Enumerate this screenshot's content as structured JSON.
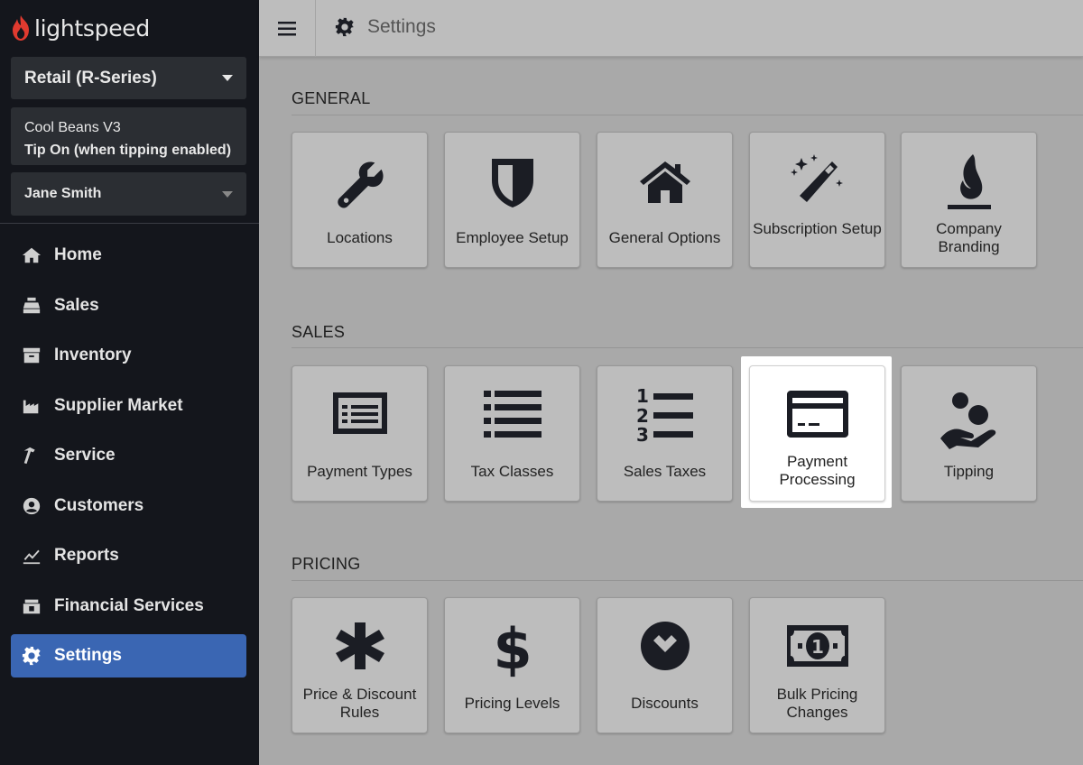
{
  "app": {
    "logo_text": "lightspeed"
  },
  "sidebar": {
    "product_selector": "Retail (R-Series)",
    "shop": {
      "name": "Cool Beans V3",
      "tip_status": "Tip On (when tipping enabled)"
    },
    "user": "Jane Smith",
    "items": [
      {
        "label": "Home",
        "icon": "home-icon"
      },
      {
        "label": "Sales",
        "icon": "register-icon"
      },
      {
        "label": "Inventory",
        "icon": "inventory-icon"
      },
      {
        "label": "Supplier Market",
        "icon": "factory-icon"
      },
      {
        "label": "Service",
        "icon": "hammer-icon"
      },
      {
        "label": "Customers",
        "icon": "user-circle-icon"
      },
      {
        "label": "Reports",
        "icon": "chart-line-icon"
      },
      {
        "label": "Financial Services",
        "icon": "cash-register-icon"
      },
      {
        "label": "Settings",
        "icon": "gear-icon",
        "active": true
      }
    ]
  },
  "header": {
    "title": "Settings"
  },
  "sections": {
    "general": {
      "title": "GENERAL",
      "tiles": [
        {
          "label": "Locations",
          "icon": "wrench-icon"
        },
        {
          "label": "Employee Setup",
          "icon": "shield-icon"
        },
        {
          "label": "General Options",
          "icon": "house-icon"
        },
        {
          "label": "Subscription Setup",
          "icon": "magic-wand-icon"
        },
        {
          "label": "Company Branding",
          "icon": "flame-icon"
        }
      ]
    },
    "sales": {
      "title": "SALES",
      "tiles": [
        {
          "label": "Payment Types",
          "icon": "money-list-icon"
        },
        {
          "label": "Tax Classes",
          "icon": "list-icon"
        },
        {
          "label": "Sales Taxes",
          "icon": "numbered-list-icon"
        },
        {
          "label": "Payment Processing",
          "icon": "credit-card-icon",
          "highlighted": true
        },
        {
          "label": "Tipping",
          "icon": "hand-coins-icon"
        }
      ]
    },
    "pricing": {
      "title": "PRICING",
      "tiles": [
        {
          "label": "Price & Discount Rules",
          "icon": "asterisk-icon"
        },
        {
          "label": "Pricing Levels",
          "icon": "dollar-icon"
        },
        {
          "label": "Discounts",
          "icon": "chevron-circle-down-icon"
        },
        {
          "label": "Bulk Pricing Changes",
          "icon": "bill-icon"
        }
      ]
    }
  },
  "colors": {
    "sidebar_bg": "#14161c",
    "active_nav": "#3a66b3",
    "logo_flame": "#e03a2f",
    "overlay_bg": "#a9a9a9"
  }
}
